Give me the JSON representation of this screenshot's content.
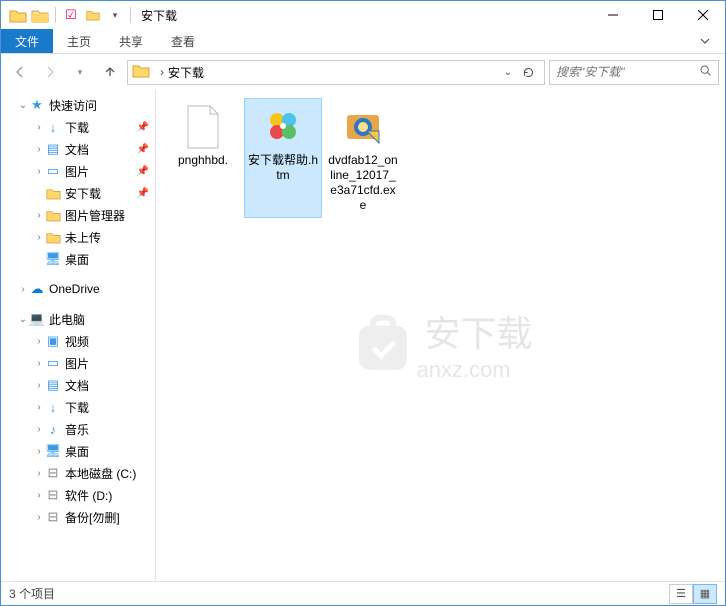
{
  "window": {
    "title": "安下载"
  },
  "ribbon": {
    "tabs": [
      "文件",
      "主页",
      "共享",
      "查看"
    ]
  },
  "address": {
    "path": "安下载"
  },
  "search": {
    "placeholder": "搜索\"安下载\""
  },
  "sidebar": {
    "quickAccess": "快速访问",
    "downloads": "下载",
    "documents": "文档",
    "pictures": "图片",
    "anxz": "安下载",
    "picManager": "图片管理器",
    "notUploaded": "未上传",
    "desktop": "桌面",
    "onedrive": "OneDrive",
    "thisPC": "此电脑",
    "videos": "视频",
    "pcPictures": "图片",
    "pcDocuments": "文档",
    "pcDownloads": "下载",
    "music": "音乐",
    "pcDesktop": "桌面",
    "localDisk": "本地磁盘 (C:)",
    "software": "软件 (D:)",
    "backup": "备份[勿删]"
  },
  "files": [
    {
      "name": "pnghhbd."
    },
    {
      "name": "安下载帮助.htm"
    },
    {
      "name": "dvdfab12_online_12017_e3a71cfd.exe"
    }
  ],
  "watermark": {
    "main": "安下载",
    "sub": "anxz.com"
  },
  "status": {
    "text": "3 个项目"
  }
}
